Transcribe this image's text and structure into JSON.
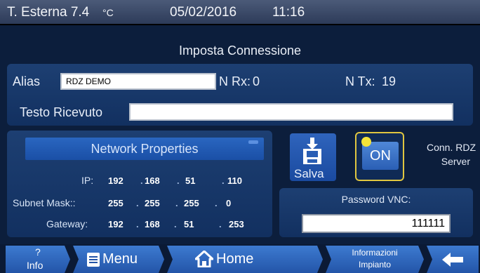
{
  "status": {
    "temperature": "T. Esterna 7.4",
    "unit": "°C",
    "date": "05/02/2016",
    "time": "11:16"
  },
  "title": "Imposta Connessione",
  "connection": {
    "alias_label": "Alias",
    "alias_value": "RDZ DEMO",
    "nrx_label": "N Rx:",
    "nrx_value": "0",
    "ntx_label": "N Tx:",
    "ntx_value": "19",
    "received_label": "Testo Ricevuto",
    "received_value": ""
  },
  "network": {
    "header": "Network Properties",
    "rows": [
      {
        "label": "IP:",
        "octets": [
          "192",
          "168",
          "51",
          "110"
        ]
      },
      {
        "label": "Subnet Mask::",
        "octets": [
          "255",
          "255",
          "255",
          "0"
        ]
      },
      {
        "label": "Gateway:",
        "octets": [
          "192",
          "168",
          "51",
          "253"
        ]
      }
    ]
  },
  "actions": {
    "save_label": "Salva",
    "on_label": "ON",
    "conn_line1": "Conn. RDZ",
    "conn_line2": "Server"
  },
  "vnc": {
    "label": "Password VNC:",
    "value": "111111"
  },
  "nav": {
    "info_symbol": "?",
    "info_label": "Info",
    "menu_label": "Menu",
    "home_label": "Home",
    "impianto_line1": "Informazioni",
    "impianto_line2": "Impianto"
  },
  "icons": {
    "save": "floppy-download-icon",
    "menu": "list-icon",
    "home": "house-icon",
    "back": "left-arrow-icon",
    "led": "yellow-led-icon"
  },
  "colors": {
    "background": "#0c1e3c",
    "panel": "#1d3f72",
    "button": "#2a5eb4",
    "led": "#f5e438",
    "on_border": "#e0c640"
  }
}
